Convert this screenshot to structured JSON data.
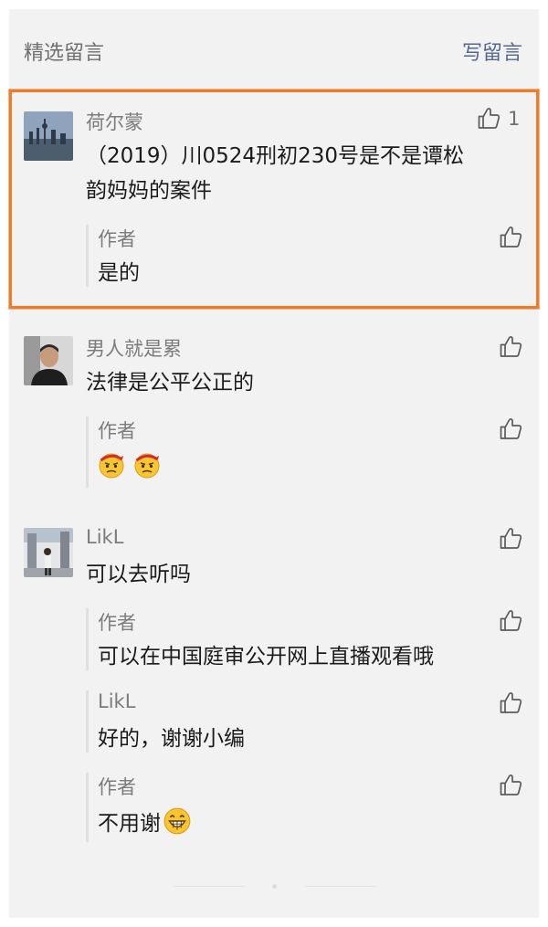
{
  "header": {
    "title": "精选留言",
    "write_label": "写留言"
  },
  "comments": [
    {
      "user": "荷尔蒙",
      "text": "（2019）川0524刑初230号是不是谭松",
      "text2": "韵妈妈的案件",
      "likes": "1",
      "reply": {
        "author": "作者",
        "text": "是的"
      }
    },
    {
      "user": "男人就是累",
      "text": "法律是公平公正的",
      "reply": {
        "author": "作者",
        "emoji": [
          "confused-face-emoji",
          "confused-face-emoji"
        ]
      }
    },
    {
      "user": "LikL",
      "text": "可以去听吗",
      "replies": [
        {
          "author": "作者",
          "text": "可以在中国庭审公开网上直播观看哦"
        },
        {
          "author": "LikL",
          "text": "好的，谢谢小编"
        },
        {
          "author": "作者",
          "text": "不用谢",
          "emoji": "grinning-face-emoji"
        }
      ]
    }
  ],
  "colors": {
    "highlight_border": "#ee7b2a",
    "link": "#55698d",
    "panel": "#f2f2f2"
  }
}
